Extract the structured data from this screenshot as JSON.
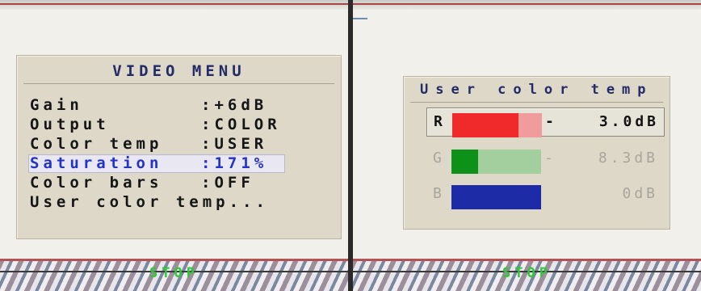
{
  "footer": {
    "stop_label": "STOP"
  },
  "video_menu": {
    "title": "VIDEO MENU",
    "items": [
      {
        "label": "Gain",
        "separator": ":",
        "value": "+6dB",
        "selected": false
      },
      {
        "label": "Output",
        "separator": ":",
        "value": "COLOR",
        "selected": false
      },
      {
        "label": "Color temp",
        "separator": ":",
        "value": "USER",
        "selected": false
      },
      {
        "label": "Saturation",
        "separator": ":",
        "value": "171%",
        "selected": true
      },
      {
        "label": "Color bars",
        "separator": ":",
        "value": "OFF",
        "selected": false
      },
      {
        "label": "User color temp...",
        "separator": "",
        "value": "",
        "selected": false
      }
    ]
  },
  "user_color_temp": {
    "title": "User color temp",
    "rows": [
      {
        "channel": "R",
        "sign": "-",
        "value": "3.0dB",
        "level": 0.74,
        "active": true,
        "fill_color": "#f02a2a",
        "track_color": "#f19c9c"
      },
      {
        "channel": "G",
        "sign": "-",
        "value": "8.3dB",
        "level": 0.3,
        "active": false,
        "fill_color": "#0e9119",
        "track_color": "#a3cf9f"
      },
      {
        "channel": "B",
        "sign": "",
        "value": "0dB",
        "level": 1.0,
        "active": false,
        "fill_color": "#1e2ba7",
        "track_color": "#1e2ba7"
      }
    ]
  }
}
